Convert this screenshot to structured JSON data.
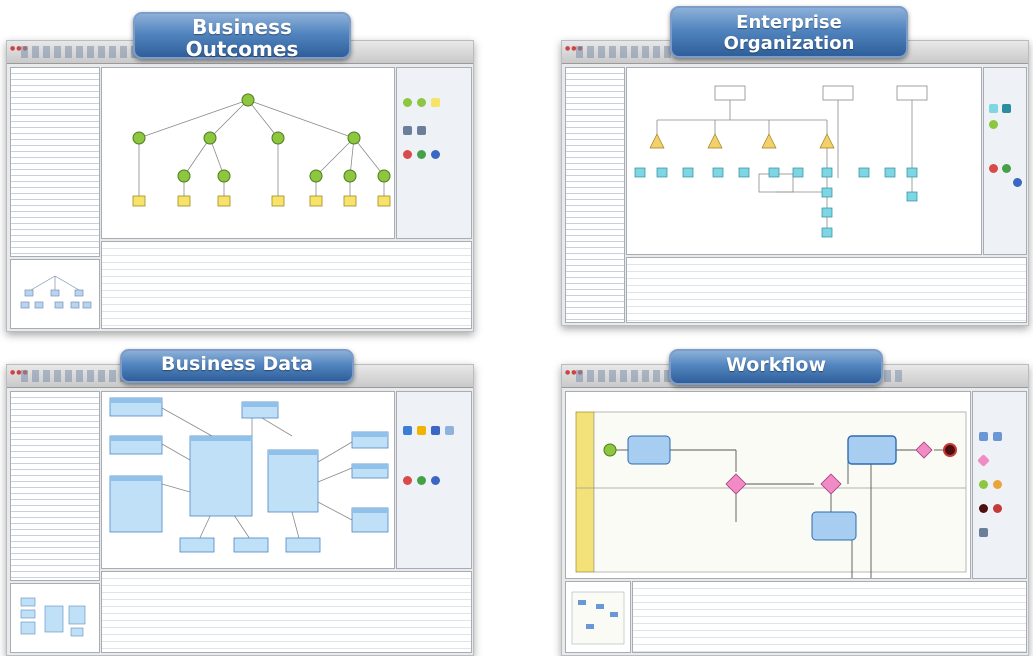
{
  "panels": [
    {
      "id": "business-outcomes",
      "label": "Business Outcomes"
    },
    {
      "id": "enterprise-organization",
      "label": "Enterprise Organization"
    },
    {
      "id": "business-data",
      "label": "Business Data"
    },
    {
      "id": "workflow",
      "label": "Workflow"
    }
  ],
  "colors": {
    "pill_top": "#8cb0d8",
    "pill_bottom": "#2f5f9a",
    "goal_node": "#8dc63f",
    "outcome_doc": "#f7e36a",
    "entity_box": "#bfe0f7",
    "gateway": "#f08bc6",
    "task_box": "#a7cdf0",
    "role_node": "#7fd6e3"
  }
}
